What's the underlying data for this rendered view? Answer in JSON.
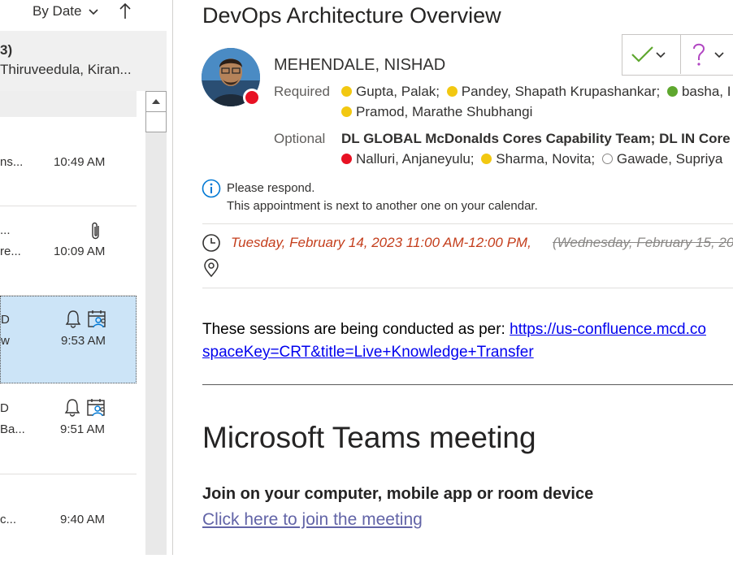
{
  "list": {
    "sort_label": "By Date",
    "group_count": "3)",
    "group_names": "Thiruveedula, Kiran...",
    "items": [
      {
        "line1": "",
        "line2": "ns...",
        "time": "10:49 AM",
        "icons": []
      },
      {
        "line1": "...",
        "line2": "re...",
        "time": "10:09 AM",
        "icons": [
          "paperclip-icon"
        ]
      },
      {
        "line1": "D",
        "line2": "w",
        "time": "9:53 AM",
        "icons": [
          "bell-icon",
          "calendar-people-icon"
        ],
        "selected": true
      },
      {
        "line1": "D",
        "line2": "Ba...",
        "time": "9:51 AM",
        "icons": [
          "bell-icon",
          "calendar-people-icon"
        ]
      },
      {
        "line1": "",
        "line2": "c...",
        "time": "9:40 AM",
        "icons": []
      }
    ]
  },
  "meeting": {
    "subject": "DevOps Architecture Overview",
    "sender": "MEHENDALE, NISHAD",
    "required_label": "Required",
    "optional_label": "Optional",
    "required_line1": [
      {
        "name": "Gupta, Palak;",
        "status": "tentative"
      },
      {
        "name": "Pandey, Shapath Krupashankar;",
        "status": "tentative"
      },
      {
        "name": "basha, I",
        "status": "accepted"
      }
    ],
    "required_line2": [
      {
        "name": "Pramod, Marathe Shubhangi",
        "status": "tentative"
      }
    ],
    "optional_line1": "DL GLOBAL McDonalds Cores Capability Team; DL IN Core",
    "optional_line2": [
      {
        "name": "Nalluri, Anjaneyulu;",
        "status": "busy"
      },
      {
        "name": "Sharma, Novita;",
        "status": "tentative"
      },
      {
        "name": "Gawade, Supriya",
        "status": "none"
      }
    ],
    "info_line1": "Please respond.",
    "info_line2": "This appointment is next to another one on your calendar.",
    "time_new": "Tuesday, February 14, 2023 11:00 AM-12:00 PM,",
    "time_old": "(Wednesday, February 15, 20",
    "body_text": "These sessions are being conducted as per: ",
    "body_link1": "https://us-confluence.mcd.co",
    "body_link2": "spaceKey=CRT&title=Live+Knowledge+Transfer",
    "teams_title": "Microsoft Teams meeting",
    "join_heading": "Join on your computer, mobile app or room device",
    "join_link": "Click here to join the meeting"
  },
  "colors": {
    "accent": "#0078d4",
    "selected_bg": "#cce4f7",
    "time_changed": "#c43e1c",
    "accept_green": "#5ea72e",
    "tentative_yellow": "#f2c811",
    "busy_red": "#e81123",
    "teams_link": "#6264a7"
  }
}
